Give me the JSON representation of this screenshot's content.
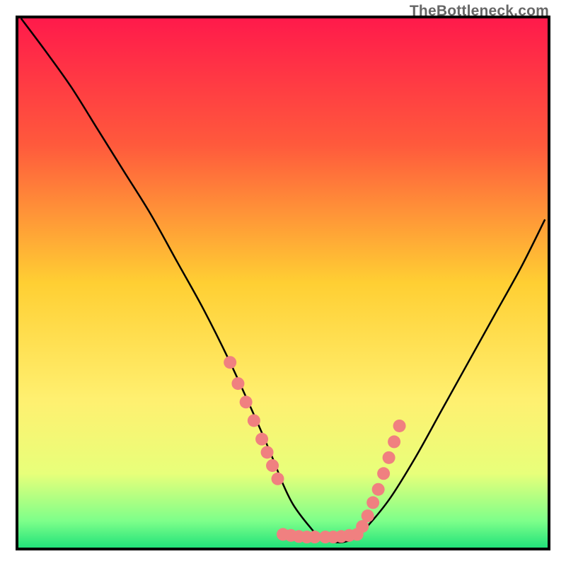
{
  "watermark": "TheBottleneck.com",
  "chart_data": {
    "type": "line",
    "title": "",
    "xlabel": "",
    "ylabel": "",
    "xlim": [
      0,
      100
    ],
    "ylim": [
      0,
      100
    ],
    "gradient_stops": [
      {
        "offset": 0,
        "color": "#ff1a4b"
      },
      {
        "offset": 24,
        "color": "#ff5a3c"
      },
      {
        "offset": 50,
        "color": "#ffcf33"
      },
      {
        "offset": 72,
        "color": "#fff070"
      },
      {
        "offset": 86,
        "color": "#e8ff7a"
      },
      {
        "offset": 95,
        "color": "#7dff8a"
      },
      {
        "offset": 100,
        "color": "#22e27a"
      }
    ],
    "series": [
      {
        "name": "bottleneck-curve",
        "x": [
          0.5,
          5,
          10,
          15,
          20,
          25,
          30,
          35,
          40,
          45,
          48,
          50,
          52,
          55,
          57,
          60,
          63,
          65,
          70,
          75,
          80,
          85,
          90,
          95,
          99.5
        ],
        "y": [
          100,
          94,
          87,
          79,
          71,
          63,
          54,
          45,
          35,
          24,
          17,
          12,
          8,
          4,
          2,
          1,
          1.5,
          3,
          9,
          17,
          26,
          35,
          44,
          53,
          62
        ]
      }
    ],
    "highlight_segments": [
      {
        "name": "left-dots",
        "x": [
          40,
          41.5,
          43,
          44.5,
          46,
          47,
          48,
          49
        ],
        "y": [
          35,
          31,
          27.5,
          24,
          20.5,
          18,
          15.5,
          13
        ]
      },
      {
        "name": "valley-dots-left",
        "x": [
          50,
          51.5,
          53,
          54.5,
          56
        ],
        "y": [
          2.5,
          2.3,
          2.1,
          2.0,
          2.0
        ]
      },
      {
        "name": "valley-dots-right",
        "x": [
          58,
          59.5,
          61,
          62.5,
          64
        ],
        "y": [
          2.0,
          2.0,
          2.1,
          2.3,
          2.5
        ]
      },
      {
        "name": "right-dots",
        "x": [
          65,
          66,
          67,
          68,
          69,
          70,
          71,
          72
        ],
        "y": [
          4,
          6,
          8.5,
          11,
          14,
          17,
          20,
          23
        ]
      }
    ],
    "dot_color": "#f08080",
    "dot_radius": 9
  }
}
